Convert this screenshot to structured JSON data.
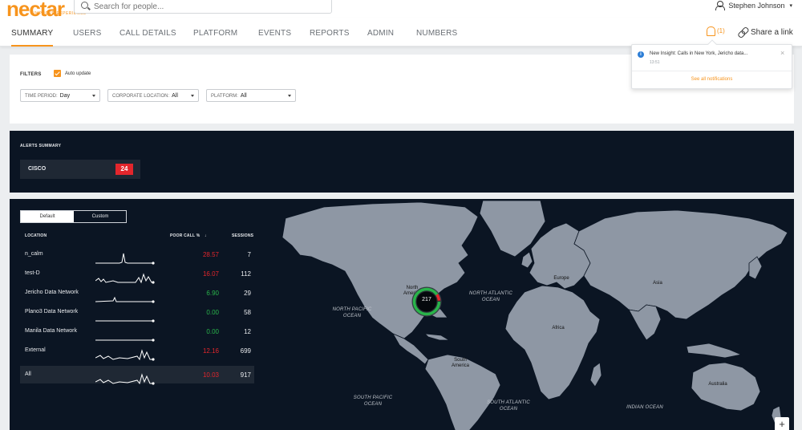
{
  "app": {
    "logo_text": "nectar",
    "logo_sub": "IMPROVE EXPERIENCE",
    "search_placeholder": "Search for people...",
    "user_name": "Stephen Johnson",
    "user_caret": "▾",
    "accent": "#f7941d"
  },
  "nav": {
    "items": [
      "SUMMARY",
      "USERS",
      "CALL DETAILS",
      "PLATFORM",
      "EVENTS",
      "REPORTS",
      "ADMIN",
      "NUMBERS"
    ],
    "active": "SUMMARY",
    "notification_count": "(1)",
    "share_label": "Share a link"
  },
  "notification": {
    "text": "New Insight: Calls in New York, Jericho data...",
    "time": "13:51",
    "close": "×",
    "see_all": "See all notifications"
  },
  "filters": {
    "title": "FILTERS",
    "auto_update_label": "Auto update",
    "auto_update_checked": true,
    "time_period": {
      "label": "TIME PERIOD:",
      "value": "Day"
    },
    "corporate_location": {
      "label": "CORPORATE LOCATION:",
      "value": "All"
    },
    "platform": {
      "label": "PLATFORM:",
      "value": "All"
    }
  },
  "alerts": {
    "title": "ALERTS SUMMARY",
    "items": [
      {
        "label": "CISCO",
        "count": "24"
      }
    ],
    "badge_color": "#e3262c"
  },
  "table": {
    "toggle": {
      "default": "Default",
      "custom": "Custom",
      "selected": "Default"
    },
    "headers": {
      "location": "LOCATION",
      "poor_call": "POOR CALL %",
      "sort": "↓",
      "sessions": "SESSIONS"
    },
    "rows": [
      {
        "location": "n_calm",
        "poor_call": "28.57",
        "sessions": "7",
        "status": "red"
      },
      {
        "location": "test-D",
        "poor_call": "16.07",
        "sessions": "112",
        "status": "red"
      },
      {
        "location": "Jericho Data Network",
        "poor_call": "6.90",
        "sessions": "29",
        "status": "green"
      },
      {
        "location": "Plano3 Data Network",
        "poor_call": "0.00",
        "sessions": "58",
        "status": "green"
      },
      {
        "location": "Manila Data Network",
        "poor_call": "0.00",
        "sessions": "12",
        "status": "green"
      },
      {
        "location": "External",
        "poor_call": "12.16",
        "sessions": "699",
        "status": "red"
      },
      {
        "location": "All",
        "poor_call": "10.03",
        "sessions": "917",
        "status": "red"
      }
    ],
    "status_colors": {
      "red": "#e3262c",
      "green": "#29b34a"
    }
  },
  "map": {
    "oceans": [
      "NORTH PACIFIC\nOCEAN",
      "NORTH ATLANTIC\nOCEAN",
      "SOUTH PACIFIC\nOCEAN",
      "SOUTH ATLANTIC\nOCEAN",
      "INDIAN OCEAN"
    ],
    "continents": [
      "North\nAmerica",
      "Europe",
      "Asia",
      "Africa",
      "South\nAmerica",
      "Australia"
    ],
    "cluster_count": "217",
    "zoom_in": "+",
    "land_color": "#8e97a4",
    "sea_color": "#0b1523"
  }
}
